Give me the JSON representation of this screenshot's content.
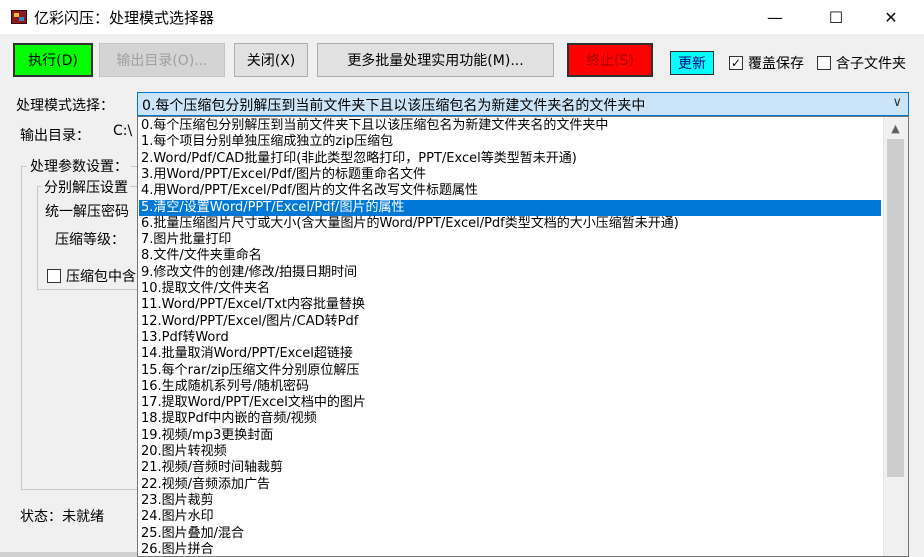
{
  "window": {
    "title": "亿彩闪压：处理模式选择器",
    "minimize_glyph": "—",
    "maximize_glyph": "☐",
    "close_glyph": "✕"
  },
  "toolbar": {
    "execute": "执行(D)",
    "output_dir": "输出目录(O)...",
    "close": "关闭(X)",
    "more_features": "更多批量处理实用功能(M)...",
    "stop": "终止(S)",
    "refresh": "更新",
    "overwrite_save": "覆盖保存",
    "overwrite_checked": "✓",
    "include_subfolders": "含子文件夹",
    "include_checked": ""
  },
  "mode": {
    "label": "处理模式选择：",
    "selected": "0.每个压缩包分别解压到当前文件夹下且以该压缩包名为新建文件夹名的文件夹中",
    "arrow": "∨",
    "selected_index": 5,
    "options": [
      "0.每个压缩包分别解压到当前文件夹下且以该压缩包名为新建文件夹名的文件夹中",
      "1.每个项目分别单独压缩成独立的zip压缩包",
      "2.Word/Pdf/CAD批量打印(非此类型忽略打印，PPT/Excel等类型暂未开通)",
      "3.用Word/PPT/Excel/Pdf/图片的标题重命名文件",
      "4.用Word/PPT/Excel/Pdf/图片的文件名改写文件标题属性",
      "5.清空/设置Word/PPT/Excel/Pdf/图片的属性",
      "6.批量压缩图片尺寸或大小(含大量图片的Word/PPT/Excel/Pdf类型文档的大小压缩暂未开通)",
      "7.图片批量打印",
      "8.文件/文件夹重命名",
      "9.修改文件的创建/修改/拍摄日期时间",
      "10.提取文件/文件夹名",
      "11.Word/PPT/Excel/Txt内容批量替换",
      "12.Word/PPT/Excel/图片/CAD转Pdf",
      "13.Pdf转Word",
      "14.批量取消Word/PPT/Excel超链接",
      "15.每个rar/zip压缩文件分别原位解压",
      "16.生成随机系列号/随机密码",
      "17.提取Word/PPT/Excel文档中的图片",
      "18.提取Pdf中内嵌的音频/视频",
      "19.视频/mp3更换封面",
      "20.图片转视频",
      "21.视频/音频时间轴裁剪",
      "22.视频/音频添加广告",
      "23.图片裁剪",
      "24.图片水印",
      "25.图片叠加/混合",
      "26.图片拼合"
    ]
  },
  "output": {
    "label": "输出目录：",
    "value": "C:\\"
  },
  "params": {
    "label": "处理参数设置：",
    "extract_settings": "分别解压设置",
    "unified_password": "统一解压密码",
    "compression_level": "压缩等级：",
    "in_archive": "压缩包中含"
  },
  "status": {
    "label": "状态：未就绪"
  }
}
